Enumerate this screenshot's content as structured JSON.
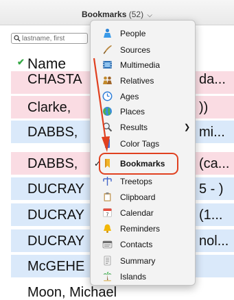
{
  "toolbar": {
    "view_name": "Bookmarks",
    "view_count": "(52)",
    "chevron": "⌵"
  },
  "search": {
    "placeholder": "lastname, first"
  },
  "list": {
    "column_header": "Name",
    "rows": [
      {
        "text": "CHASTA",
        "right": "da...",
        "color": "pink"
      },
      {
        "text": "Clarke, ",
        "right": "))",
        "color": "pink"
      },
      {
        "text": "DABBS, ",
        "right": "mi...",
        "color": "blue"
      },
      {
        "text": "DABBS, ",
        "right": "(ca...",
        "color": "pink"
      },
      {
        "text": "DUCRAY",
        "right": "5 - )",
        "color": "blue"
      },
      {
        "text": "DUCRAY",
        "right": "(1...",
        "color": "blue"
      },
      {
        "text": "DUCRAY",
        "right": "nol...",
        "color": "blue"
      },
      {
        "text": "McGEHE",
        "right": "",
        "color": "blue"
      },
      {
        "text": "Moon, Michael",
        "right": "",
        "color": "white"
      }
    ]
  },
  "menu": {
    "items": [
      {
        "label": "People",
        "icon": "person-icon"
      },
      {
        "label": "Sources",
        "icon": "quill-icon"
      },
      {
        "label": "Multimedia",
        "icon": "film-icon"
      },
      {
        "label": "Relatives",
        "icon": "relatives-icon"
      },
      {
        "label": "Ages",
        "icon": "clock-icon"
      },
      {
        "label": "Places",
        "icon": "globe-icon"
      },
      {
        "label": "Results",
        "icon": "magnifier-icon",
        "submenu": true
      },
      {
        "label": "Color Tags",
        "icon": "tag-icon"
      },
      {
        "label": "Bookmarks",
        "icon": "bookmark-icon",
        "checked": true
      },
      {
        "label": "Treetops",
        "icon": "tree-icon"
      },
      {
        "label": "Clipboard",
        "icon": "clipboard-icon"
      },
      {
        "label": "Calendar",
        "icon": "calendar-icon",
        "icon_text": "7"
      },
      {
        "label": "Reminders",
        "icon": "bell-icon"
      },
      {
        "label": "Contacts",
        "icon": "contacts-icon"
      },
      {
        "label": "Summary",
        "icon": "summary-icon"
      },
      {
        "label": "Islands",
        "icon": "palm-icon"
      }
    ],
    "check_mark": "✓",
    "submenu_arrow": "❯"
  },
  "header_check": "✔",
  "colors": {
    "highlight": "#e0401f",
    "row_pink": "#fadce3",
    "row_blue": "#dae9fa",
    "check_green": "#35a845"
  }
}
